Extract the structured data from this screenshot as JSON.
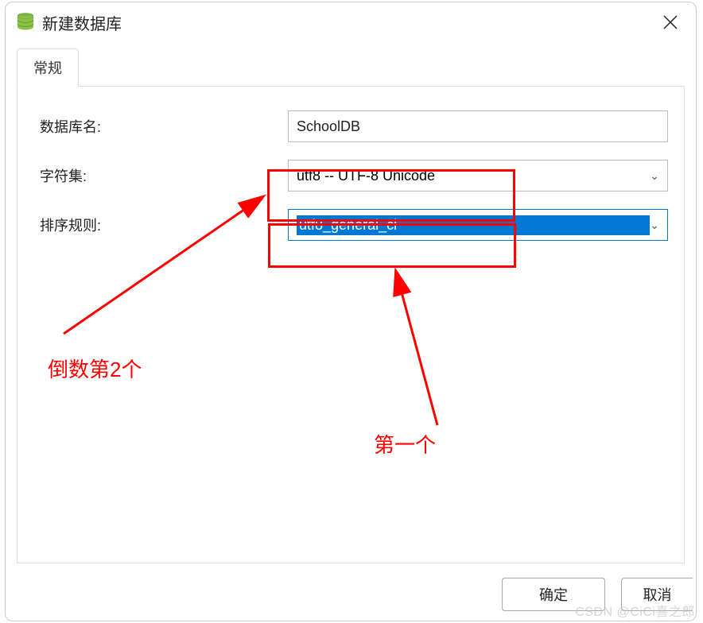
{
  "dialog": {
    "title": "新建数据库",
    "tabs": [
      {
        "label": "常规"
      }
    ],
    "fields": {
      "db_name": {
        "label": "数据库名:",
        "value": "SchoolDB"
      },
      "charset": {
        "label": "字符集:",
        "value": "utf8 -- UTF-8 Unicode"
      },
      "collation": {
        "label": "排序规则:",
        "value": "utf8_general_ci"
      }
    },
    "buttons": {
      "ok": "确定",
      "cancel": "取消"
    }
  },
  "annotations": {
    "note1": "倒数第2个",
    "note2": "第一个"
  },
  "watermark": "CSDN @CiCi喜之郎"
}
